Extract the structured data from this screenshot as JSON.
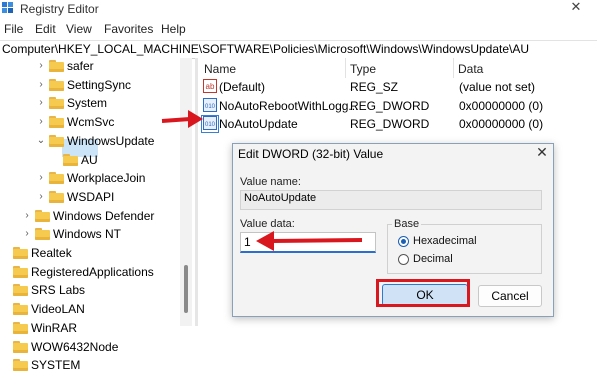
{
  "window": {
    "title": "Registry Editor",
    "close_glyph": "✕"
  },
  "menu": [
    "File",
    "Edit",
    "View",
    "Favorites",
    "Help"
  ],
  "address": "Computer\\HKEY_LOCAL_MACHINE\\SOFTWARE\\Policies\\Microsoft\\Windows\\WindowsUpdate\\AU",
  "tree": [
    {
      "label": "safer",
      "chevron": "›"
    },
    {
      "label": "SettingSync",
      "chevron": "›"
    },
    {
      "label": "System",
      "chevron": "›"
    },
    {
      "label": "WcmSvc",
      "chevron": "›"
    },
    {
      "label": "WindowsUpdate",
      "chevron": "⌄"
    },
    {
      "label": "AU",
      "chevron": ""
    },
    {
      "label": "WorkplaceJoin",
      "chevron": "›"
    },
    {
      "label": "WSDAPI",
      "chevron": "›"
    },
    {
      "label": "Windows Defender",
      "chevron": "›"
    },
    {
      "label": "Windows NT",
      "chevron": "›"
    },
    {
      "label": "Realtek",
      "chevron": ""
    },
    {
      "label": "RegisteredApplications",
      "chevron": ""
    },
    {
      "label": "SRS Labs",
      "chevron": ""
    },
    {
      "label": "VideoLAN",
      "chevron": ""
    },
    {
      "label": "WinRAR",
      "chevron": ""
    },
    {
      "label": "WOW6432Node",
      "chevron": ""
    },
    {
      "label": "SYSTEM",
      "chevron": ""
    }
  ],
  "list": {
    "headers": {
      "name": "Name",
      "type": "Type",
      "data": "Data"
    },
    "rows": [
      {
        "name": "(Default)",
        "type": "REG_SZ",
        "data": "(value not set)",
        "icon": "string-value-icon",
        "icon_text": "ab"
      },
      {
        "name": "NoAutoRebootWithLogg...",
        "type": "REG_DWORD",
        "data": "0x00000000 (0)",
        "icon": "dword-value-icon",
        "icon_text": "010"
      },
      {
        "name": "NoAutoUpdate",
        "type": "REG_DWORD",
        "data": "0x00000000 (0)",
        "icon": "dword-value-icon",
        "icon_text": "010"
      }
    ]
  },
  "dialog": {
    "title": "Edit DWORD (32-bit) Value",
    "close_glyph": "✕",
    "value_name_label": "Value name:",
    "value_name": "NoAutoUpdate",
    "value_data_label": "Value data:",
    "value_data": "1",
    "base_label": "Base",
    "base_options": [
      "Hexadecimal",
      "Decimal"
    ],
    "base_selected": "Hexadecimal",
    "ok_label": "OK",
    "cancel_label": "Cancel"
  },
  "colors": {
    "arrow_red": "#d8171f",
    "selection": "#cce4f7",
    "accent": "#2f79d1"
  }
}
